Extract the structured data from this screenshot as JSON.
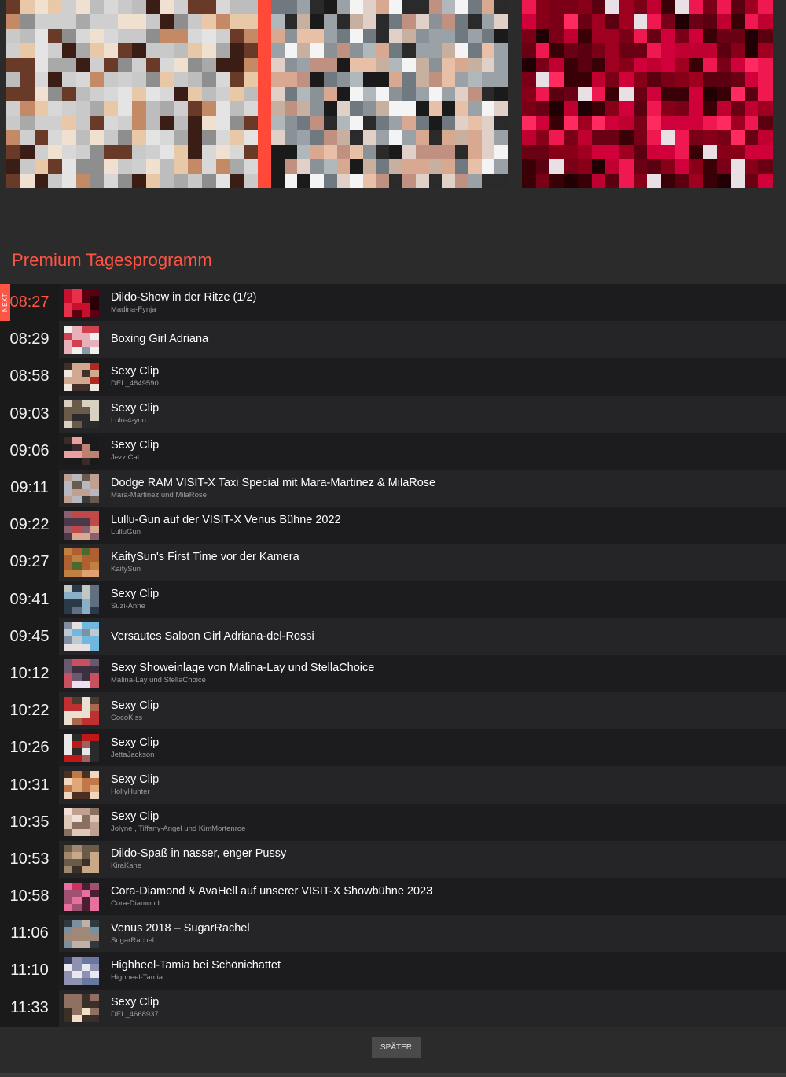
{
  "previews": [
    {
      "name": "preview-1",
      "palette": [
        "#d8d8d8",
        "#cfcfcf",
        "#e4e4e4",
        "#bdbdbd",
        "#c9c9c9",
        "#a9a9a9",
        "#e9c8a8",
        "#c48a66",
        "#6a3a28",
        "#3a1e16",
        "#f0e0d0",
        "#8e8e8e"
      ]
    },
    {
      "name": "preview-2",
      "palette": [
        "#9aa2a8",
        "#c8b0a0",
        "#e8c0a8",
        "#d8a890",
        "#2a2a2a",
        "#b0b8bc",
        "#f4f4f4",
        "#707880",
        "#e0d0c8",
        "#c09080",
        "#1a1a1a",
        "#8a9298"
      ]
    },
    {
      "name": "preview-3",
      "palette": [
        "#3a0008",
        "#5a0010",
        "#7a0018",
        "#a00020",
        "#d0003a",
        "#f01850",
        "#ff2a60",
        "#200004",
        "#880018",
        "#c00030",
        "#e8e0e4",
        "#6a0014"
      ]
    }
  ],
  "section_title": "Premium Tagesprogramm",
  "next_label": "NEXT",
  "later_button": "SPÄTER",
  "program": [
    {
      "time": "08:27",
      "title": "Dildo-Show in der Ritze (1/2)",
      "sub": "Madina-Fynja",
      "palette": [
        "#5a0010",
        "#c8102e",
        "#e8304a",
        "#2a0008"
      ]
    },
    {
      "time": "08:29",
      "title": "Boxing Girl Adriana",
      "sub": "",
      "palette": [
        "#8a9aa8",
        "#e8b0b8",
        "#f0f0f0",
        "#d04050"
      ]
    },
    {
      "time": "08:58",
      "title": "Sexy Clip",
      "sub": "DEL_4649590",
      "palette": [
        "#f0e8e0",
        "#d0a890",
        "#b02820",
        "#403028"
      ]
    },
    {
      "time": "09:03",
      "title": "Sexy Clip",
      "sub": "Lulu-4-you",
      "palette": [
        "#d8d0c0",
        "#6a5a48",
        "#2a2a2a",
        "#a89880"
      ]
    },
    {
      "time": "09:06",
      "title": "Sexy Clip",
      "sub": "JezziCat",
      "palette": [
        "#e8a0a0",
        "#3a2a2a",
        "#c08070",
        "#1a1a1a"
      ]
    },
    {
      "time": "09:11",
      "title": "Dodge RAM VISIT-X Taxi Special mit Mara-Martinez & MilaRose",
      "sub": "Mara-Martinez  und  MilaRose",
      "palette": [
        "#b8b8c0",
        "#6a5a50",
        "#c0a090",
        "#3a3a3a"
      ]
    },
    {
      "time": "09:22",
      "title": "Lullu-Gun auf der VISIT-X Venus Bühne 2022",
      "sub": "LulluGun",
      "palette": [
        "#c04848",
        "#4a3a48",
        "#d8a890",
        "#8a6070"
      ]
    },
    {
      "time": "09:27",
      "title": "KaitySun's First Time vor der Kamera",
      "sub": "KaitySun",
      "palette": [
        "#c08040",
        "#e0a070",
        "#4a6a30",
        "#b06030"
      ]
    },
    {
      "time": "09:41",
      "title": "Sexy Clip",
      "sub": "Suzi-Anne",
      "palette": [
        "#8ab0c8",
        "#c0c8c0",
        "#607080",
        "#2a3a48"
      ]
    },
    {
      "time": "09:45",
      "title": "Versautes Saloon Girl Adriana-del-Rossi",
      "sub": "",
      "palette": [
        "#70b8e0",
        "#c0c8d0",
        "#8090a0",
        "#e8e0e0"
      ]
    },
    {
      "time": "10:12",
      "title": "Sexy Showeinlage von Malina-Lay und StellaChoice",
      "sub": "Malina-Lay  und  StellaChoice",
      "palette": [
        "#3a3040",
        "#e8e0f0",
        "#c85060",
        "#6a5870"
      ]
    },
    {
      "time": "10:22",
      "title": "Sexy Clip",
      "sub": "CocoKiss",
      "palette": [
        "#c03030",
        "#e8e0d0",
        "#4a3a30",
        "#a86850"
      ]
    },
    {
      "time": "10:26",
      "title": "Sexy Clip",
      "sub": "JettaJackson",
      "palette": [
        "#c01818",
        "#e8e8e8",
        "#2a2a2a",
        "#a06060"
      ]
    },
    {
      "time": "10:31",
      "title": "Sexy Clip",
      "sub": "HollyHunter",
      "palette": [
        "#e0a878",
        "#c07848",
        "#4a3020",
        "#f0d8c0"
      ]
    },
    {
      "time": "10:35",
      "title": "Sexy Clip",
      "sub": "Jolyne ,  Tiffany-Angel  und  KimMortenroe",
      "palette": [
        "#e0c8b8",
        "#c0a090",
        "#8a7060",
        "#f0e0d8"
      ]
    },
    {
      "time": "10:53",
      "title": "Dildo-Spaß in nasser, enger Pussy",
      "sub": "KiraKane",
      "palette": [
        "#6a5a48",
        "#a08870",
        "#3a3028",
        "#c8a888"
      ]
    },
    {
      "time": "10:58",
      "title": "Cora-Diamond & AvaHell auf unserer VISIT-X Showbühne 2023",
      "sub": "Cora-Diamond",
      "palette": [
        "#d03060",
        "#e870a0",
        "#4a2030",
        "#a05070"
      ]
    },
    {
      "time": "11:06",
      "title": "Venus 2018 – SugarRachel",
      "sub": "SugarRachel",
      "palette": [
        "#7890a0",
        "#c0b0a8",
        "#303840",
        "#a08878"
      ]
    },
    {
      "time": "11:10",
      "title": "Highheel-Tamia bei Schönichattet",
      "sub": "Highheel-Tamia",
      "palette": [
        "#6878a0",
        "#e8e8f0",
        "#3a4060",
        "#9090b0"
      ]
    },
    {
      "time": "11:33",
      "title": "Sexy Clip",
      "sub": "DEL_4668937",
      "palette": [
        "#f0e0c8",
        "#d0a880",
        "#3a3028",
        "#907060"
      ]
    }
  ]
}
